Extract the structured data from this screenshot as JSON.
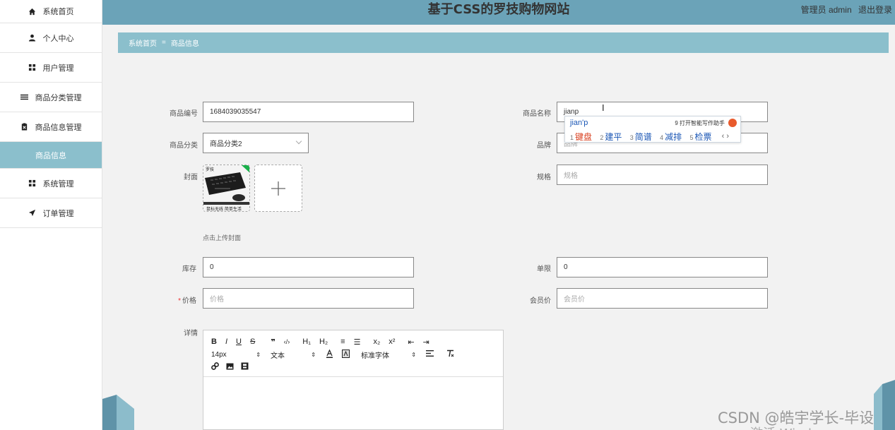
{
  "sidebar": {
    "items": [
      {
        "label": "系统首页",
        "icon": "home-icon"
      },
      {
        "label": "个人中心",
        "icon": "user-icon"
      },
      {
        "label": "用户管理",
        "icon": "grid-icon"
      },
      {
        "label": "商品分类管理",
        "icon": "list-icon"
      },
      {
        "label": "商品信息管理",
        "icon": "clipboard-icon"
      },
      {
        "label": "商品信息",
        "icon": ""
      },
      {
        "label": "系统管理",
        "icon": "grid-icon"
      },
      {
        "label": "订单管理",
        "icon": "send-icon"
      }
    ]
  },
  "header": {
    "title": "基于CSS的罗技购物网站",
    "user_label": "管理员 admin",
    "logout_label": "退出登录"
  },
  "breadcrumb": {
    "home": "系统首页",
    "separator": "=",
    "current": "商品信息"
  },
  "form": {
    "product_no": {
      "label": "商品编号",
      "value": "1684039035547"
    },
    "product_name": {
      "label": "商品名称",
      "value": "jianp"
    },
    "category": {
      "label": "商品分类",
      "value": "商品分类2"
    },
    "brand": {
      "label": "品牌",
      "placeholder": "品牌"
    },
    "cover": {
      "label": "封面",
      "hint": "点击上传封面",
      "image_caption": "鼠标无线 简单生活",
      "image_brand": "罗技"
    },
    "spec": {
      "label": "规格",
      "placeholder": "规格"
    },
    "stock": {
      "label": "库存",
      "value": "0"
    },
    "limit": {
      "label": "单限",
      "value": "0"
    },
    "price": {
      "label": "价格",
      "required_mark": "*",
      "placeholder": "价格"
    },
    "member_price": {
      "label": "会员价",
      "placeholder": "会员价"
    },
    "detail": {
      "label": "详情"
    }
  },
  "ime": {
    "pinyin": "jian'p",
    "assist": "9 打开智能写作助手",
    "candidates": [
      {
        "num": "1",
        "text": "键盘"
      },
      {
        "num": "2",
        "text": "建平"
      },
      {
        "num": "3",
        "text": "简谱"
      },
      {
        "num": "4",
        "text": "减排"
      },
      {
        "num": "5",
        "text": "检票"
      }
    ],
    "nav": "‹ ›"
  },
  "editor": {
    "toolbar_row1": [
      "B",
      "I",
      "U",
      "S",
      "❞",
      "‹/›",
      "H₁",
      "H₂",
      "≡",
      "☰",
      "x₂",
      "x²",
      "⇤",
      "⇥"
    ],
    "font_size": "14px",
    "text_style": "文本",
    "font_family": "标准字体",
    "select_arrow": "⇕"
  },
  "watermark": "CSDN @皓宇学长-毕设",
  "watermark2": "激活 Windows",
  "colors": {
    "header_bg": "#6ba3b8",
    "accent": "#8bbfcc",
    "required": "#ee3333"
  }
}
